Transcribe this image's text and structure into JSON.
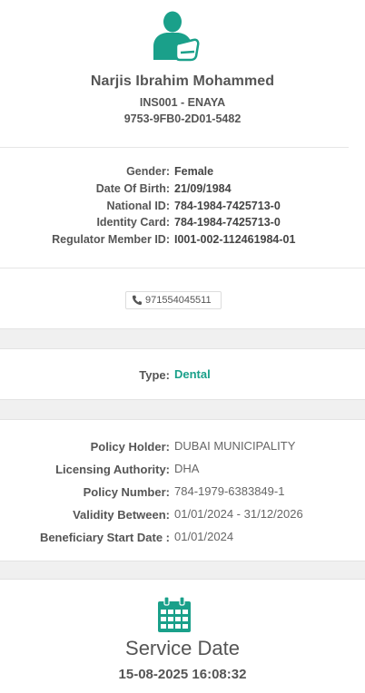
{
  "colors": {
    "accent": "#1aa08a",
    "text": "#555555",
    "band": "#f0f0f0"
  },
  "patient": {
    "icon": "patient-arm-sling-icon",
    "name": "Narjis Ibrahim Mohammed",
    "member_code": "INS001 - ENAYA",
    "card_id": "9753-9FB0-2D01-5482"
  },
  "details": [
    {
      "label": "Gender:",
      "value": "Female"
    },
    {
      "label": "Date Of Birth:",
      "value": "21/09/1984"
    },
    {
      "label": "National ID:",
      "value": "784-1984-7425713-0"
    },
    {
      "label": "Identity Card:",
      "value": "784-1984-7425713-0"
    },
    {
      "label": "Regulator Member ID:",
      "value": "I001-002-112461984-01"
    }
  ],
  "contact": {
    "icon": "phone-icon",
    "phone": "971554045511"
  },
  "coverage": {
    "type_label": "Type:",
    "type_value": "Dental"
  },
  "policy": [
    {
      "label": "Policy Holder:",
      "value": "DUBAI MUNICIPALITY"
    },
    {
      "label": "Licensing Authority:",
      "value": "DHA"
    },
    {
      "label": "Policy Number:",
      "value": "784-1979-6383849-1"
    },
    {
      "label": "Validity Between:",
      "value": "01/01/2024 - 31/12/2026"
    },
    {
      "label": "Beneficiary Start Date :",
      "value": "01/01/2024"
    }
  ],
  "service": {
    "icon": "calendar-icon",
    "title": "Service Date",
    "datetime": "15-08-2025 16:08:32"
  }
}
